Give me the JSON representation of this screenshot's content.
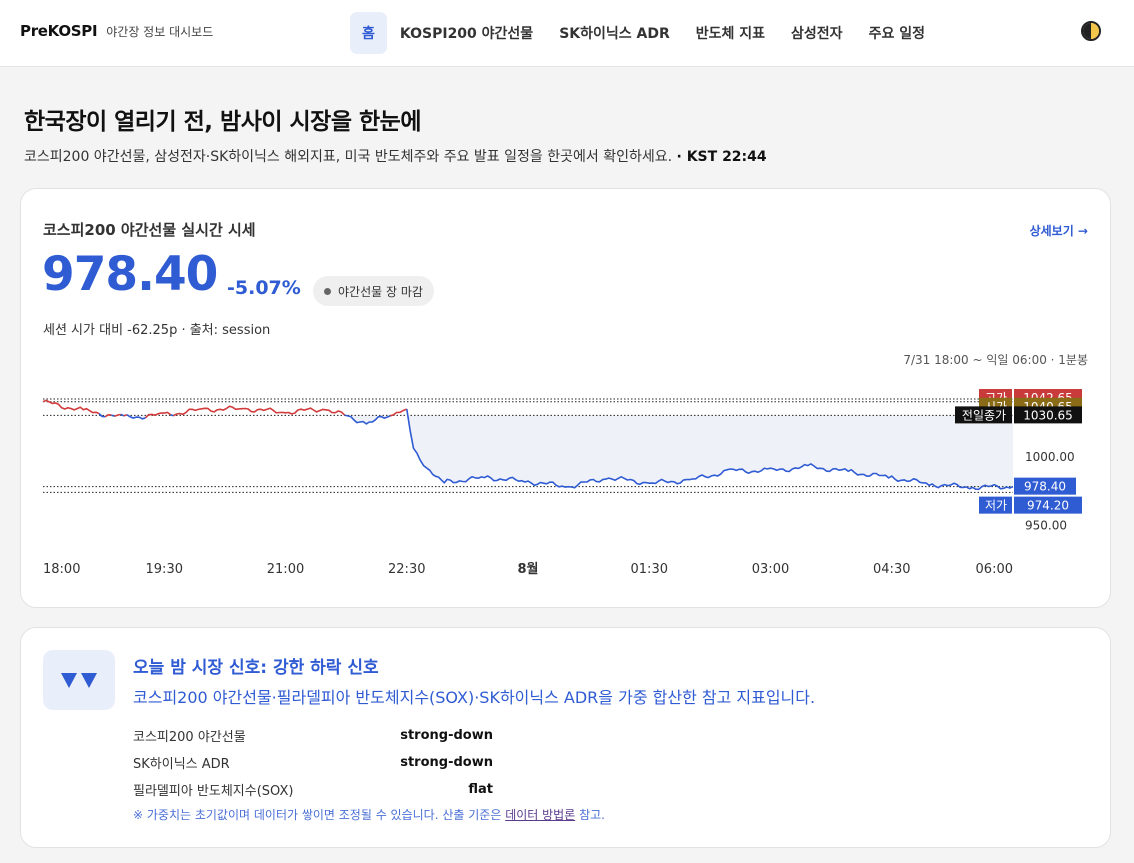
{
  "brand": {
    "name": "PreKOSPI",
    "tagline": "야간장 정보 대시보드"
  },
  "nav": {
    "items": [
      "홈",
      "KOSPI200 야간선물",
      "SK하이닉스 ADR",
      "반도체 지표",
      "삼성전자",
      "주요 일정"
    ],
    "active": "홈"
  },
  "hero": {
    "title": "한국장이 열리기 전, 밤사이 시장을 한눈에",
    "subtitle": "코스피200 야간선물, 삼성전자·SK하이닉스 해외지표, 미국 반도체주와 주요 발표 일정을 한곳에서 확인하세요.",
    "time": "· KST 22:44"
  },
  "quote": {
    "title": "코스피200 야간선물 실시간 시세",
    "more_link": "상세보기 →",
    "price": "978.40",
    "change_pct": "-5.07%",
    "status": "야간선물 장 마감",
    "meta": "세션 시가 대비 -62.25p · 출처: session",
    "range": "7/31 18:00 ~ 익일 06:00 · 1분봉"
  },
  "chart_data": {
    "type": "line",
    "x_ticks": [
      "18:00",
      "19:30",
      "21:00",
      "22:30",
      "8월",
      "01:30",
      "03:00",
      "04:30",
      "06:00"
    ],
    "y_ticks": [
      "1000.00",
      "950.00"
    ],
    "ylim": [
      940,
      1050
    ],
    "x": [
      "18:00",
      "18:30",
      "19:00",
      "19:30",
      "20:00",
      "20:30",
      "21:00",
      "21:30",
      "22:00",
      "22:20",
      "22:30",
      "22:35",
      "22:45",
      "23:00",
      "23:30",
      "00:00",
      "00:30",
      "01:00",
      "01:30",
      "02:00",
      "02:30",
      "03:00",
      "03:30",
      "04:00",
      "04:30",
      "05:00",
      "05:30",
      "06:00"
    ],
    "values": [
      1040.65,
      1034.0,
      1029.0,
      1031.0,
      1035.0,
      1035.5,
      1033.0,
      1035.5,
      1025.0,
      1031.0,
      1034.5,
      1005.0,
      990.0,
      982.0,
      985.0,
      982.0,
      978.5,
      985.0,
      981.0,
      983.0,
      990.0,
      990.0,
      993.0,
      989.0,
      985.0,
      980.0,
      978.0,
      978.4
    ],
    "reference_lines": [
      {
        "label": "고가",
        "value": "1042.65",
        "color": "#c93a3a"
      },
      {
        "label": "시가",
        "value": "1040.65",
        "color": "#8a6b16"
      },
      {
        "label": "전일종가",
        "value": "1030.65",
        "color": "#111111"
      },
      {
        "label": "저가",
        "value": "974.20",
        "color": "#2f5bd3"
      }
    ],
    "last_value": "978.40",
    "line_colors": {
      "above_prev_close": "#d23b3b",
      "below_prev_close": "#2f5bd3"
    }
  },
  "signal": {
    "title": "오늘 밤 시장 신호: 강한 하락 신호",
    "desc": "코스피200 야간선물·필라델피아 반도체지수(SOX)·SK하이닉스 ADR을 가중 합산한 참고 지표입니다.",
    "rows": [
      {
        "name": "코스피200 야간선물",
        "value": "strong-down"
      },
      {
        "name": "SK하이닉스 ADR",
        "value": "strong-down"
      },
      {
        "name": "필라델피아 반도체지수(SOX)",
        "value": "flat"
      }
    ],
    "note_prefix": "※ 가중치는 초기값이며 데이터가 쌓이면 조정될 수 있습니다. 산출 기준은 ",
    "note_link": "데이터 방법론",
    "note_suffix": " 참고."
  }
}
